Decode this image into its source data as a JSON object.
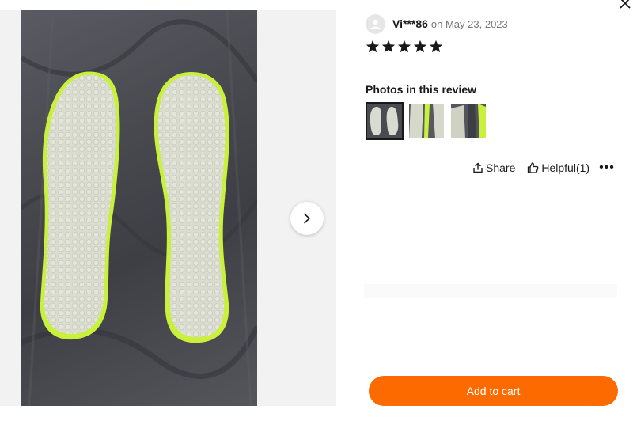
{
  "review": {
    "reviewer_name": "Vi***86",
    "date": "on May 23, 2023",
    "rating": 5,
    "rating_max": 5,
    "photos_title": "Photos in this review",
    "photo_count": 3,
    "selected_photo": 1
  },
  "actions": {
    "share_label": "Share",
    "helpful_label": "Helpful(1)",
    "more_label": "•••"
  },
  "cart": {
    "label": "Add to cart",
    "color": "#fd6a00"
  },
  "icons": {
    "close": "close-icon",
    "next": "chevron-right-icon",
    "share": "share-icon",
    "helpful": "thumbs-up-icon",
    "avatar": "user-avatar-icon",
    "star": "star-icon"
  }
}
